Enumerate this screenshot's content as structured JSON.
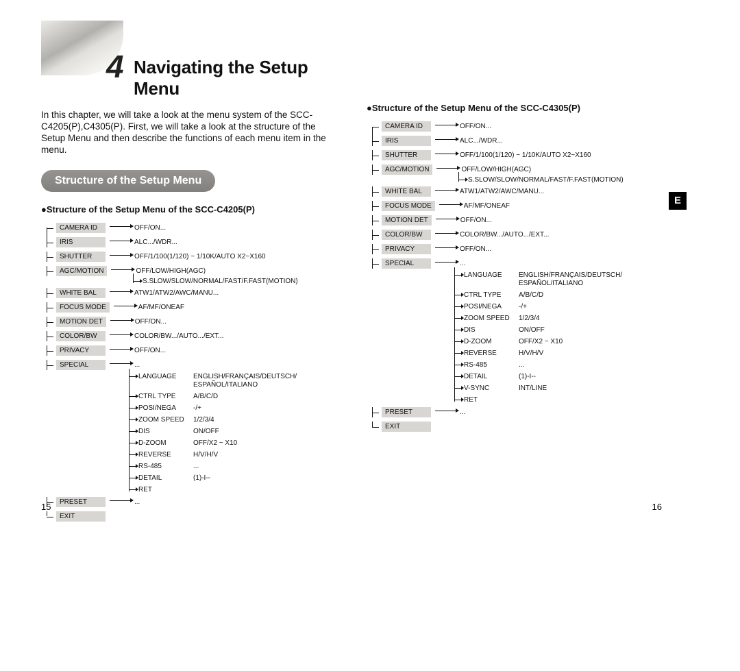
{
  "chapter": {
    "num": "4",
    "title": "Navigating the Setup Menu"
  },
  "intro": "In this chapter, we will take a look at the menu system of the SCC-C4205(P),C4305(P). First, we will take a look at the structure of the Setup Menu and then describe the functions of each menu item in the menu.",
  "section_title": "Structure of the Setup Menu",
  "bullet_prefix": "●",
  "left_heading": "Structure of the Setup Menu of the SCC-C4205(P)",
  "right_heading": "Structure of the Setup Menu of the SCC-C4305(P)",
  "tab_label": "E",
  "page_left": "15",
  "page_right": "16",
  "left_menu": [
    {
      "label": "CAMERA ID",
      "value": "OFF/ON..."
    },
    {
      "label": "IRIS",
      "value": "ALC.../WDR..."
    },
    {
      "label": "SHUTTER",
      "value": "OFF/1/100(1/120) ~ 1/10K/AUTO X2~X160"
    },
    {
      "label": "AGC/MOTION",
      "value": "OFF/LOW/HIGH(AGC)",
      "extra": "S.SLOW/SLOW/NORMAL/FAST/F.FAST(MOTION)"
    },
    {
      "label": "WHITE BAL",
      "value": "ATW1/ATW2/AWC/MANU..."
    },
    {
      "label": "FOCUS MODE",
      "value": "AF/MF/ONEAF"
    },
    {
      "label": "MOTION DET",
      "value": "OFF/ON..."
    },
    {
      "label": "COLOR/BW",
      "value": "COLOR/BW.../AUTO.../EXT..."
    },
    {
      "label": "PRIVACY",
      "value": "OFF/ON..."
    },
    {
      "label": "SPECIAL",
      "value": "...",
      "children": [
        {
          "label": "LANGUAGE",
          "value": "ENGLISH/FRANÇAIS/DEUTSCH/\nESPAÑOL/ITALIANO"
        },
        {
          "label": "CTRL TYPE",
          "value": "A/B/C/D"
        },
        {
          "label": "POSI/NEGA",
          "value": "-/+"
        },
        {
          "label": "ZOOM SPEED",
          "value": "1/2/3/4"
        },
        {
          "label": "DIS",
          "value": "ON/OFF"
        },
        {
          "label": "D-ZOOM",
          "value": "OFF/X2 ~ X10"
        },
        {
          "label": "REVERSE",
          "value": "H/V/H/V"
        },
        {
          "label": "RS-485",
          "value": "..."
        },
        {
          "label": "DETAIL",
          "value": "(1)-I--"
        },
        {
          "label": "RET",
          "value": ""
        }
      ]
    },
    {
      "label": "PRESET",
      "value": "..."
    },
    {
      "label": "EXIT",
      "value": ""
    }
  ],
  "right_menu": [
    {
      "label": "CAMERA ID",
      "value": "OFF/ON..."
    },
    {
      "label": "IRIS",
      "value": "ALC.../WDR..."
    },
    {
      "label": "SHUTTER",
      "value": "OFF/1/100(1/120) ~ 1/10K/AUTO X2~X160"
    },
    {
      "label": "AGC/MOTION",
      "value": "OFF/LOW/HIGH(AGC)",
      "extra": "S.SLOW/SLOW/NORMAL/FAST/F.FAST(MOTION)"
    },
    {
      "label": "WHITE BAL",
      "value": "ATW1/ATW2/AWC/MANU..."
    },
    {
      "label": "FOCUS MODE",
      "value": "AF/MF/ONEAF"
    },
    {
      "label": "MOTION DET",
      "value": "OFF/ON..."
    },
    {
      "label": "COLOR/BW",
      "value": "COLOR/BW.../AUTO.../EXT..."
    },
    {
      "label": "PRIVACY",
      "value": "OFF/ON..."
    },
    {
      "label": "SPECIAL",
      "value": "...",
      "children": [
        {
          "label": "LANGUAGE",
          "value": "ENGLISH/FRANÇAIS/DEUTSCH/\nESPAÑOL/ITALIANO"
        },
        {
          "label": "CTRL TYPE",
          "value": "A/B/C/D"
        },
        {
          "label": "POSI/NEGA",
          "value": "-/+"
        },
        {
          "label": "ZOOM SPEED",
          "value": "1/2/3/4"
        },
        {
          "label": "DIS",
          "value": "ON/OFF"
        },
        {
          "label": "D-ZOOM",
          "value": "OFF/X2 ~ X10"
        },
        {
          "label": "REVERSE",
          "value": "H/V/H/V"
        },
        {
          "label": "RS-485",
          "value": "..."
        },
        {
          "label": "DETAIL",
          "value": "(1)-I--"
        },
        {
          "label": "V-SYNC",
          "value": "INT/LINE"
        },
        {
          "label": "RET",
          "value": ""
        }
      ]
    },
    {
      "label": "PRESET",
      "value": "..."
    },
    {
      "label": "EXIT",
      "value": ""
    }
  ]
}
